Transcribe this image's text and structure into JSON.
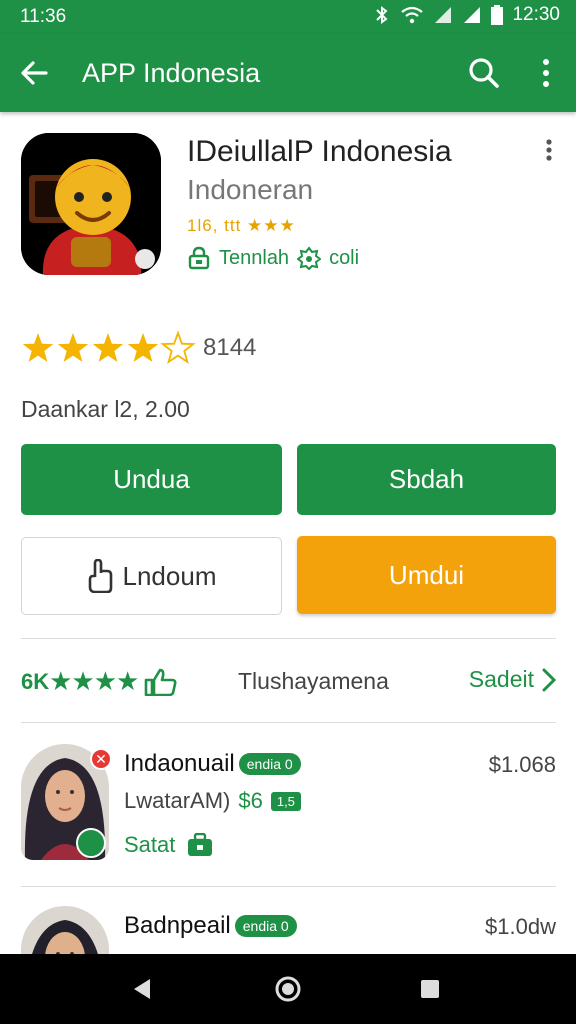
{
  "status_bar": {
    "time_left": "11:36",
    "time_right": "12:30"
  },
  "app_bar": {
    "title": "APP Indonesia"
  },
  "app": {
    "name": "IDeiullalP Indonesia",
    "developer": "Indoneran",
    "small_rating_text": "1l6, ttt",
    "tag_label": "Tennlah",
    "tag_extra": "coli"
  },
  "rating": {
    "stars": 4,
    "count": "8144"
  },
  "downloads": "Daankar l2, 2.00",
  "buttons": {
    "primary_left": "Undua",
    "primary_right": "Sbdah",
    "secondary_left": "Lndoum",
    "secondary_right": "Umdui"
  },
  "reviews_bar": {
    "left_label": "6K",
    "middle_label": "Tlushayamena",
    "right_label": "Sadeit"
  },
  "list": [
    {
      "name": "Indaonuail",
      "pill": "endia",
      "pill_num": "0",
      "sub": "LwatarAM)",
      "amount": "$6",
      "tag": "1,5",
      "status": "Satat",
      "price": "$1.068"
    },
    {
      "name": "Badnpeail",
      "pill": "endia",
      "pill_num": "0",
      "price": "$1.0dw"
    }
  ],
  "colors": {
    "brand_green": "#1e9146",
    "accent_orange": "#f4a20b",
    "star_yellow": "#f4b400"
  }
}
